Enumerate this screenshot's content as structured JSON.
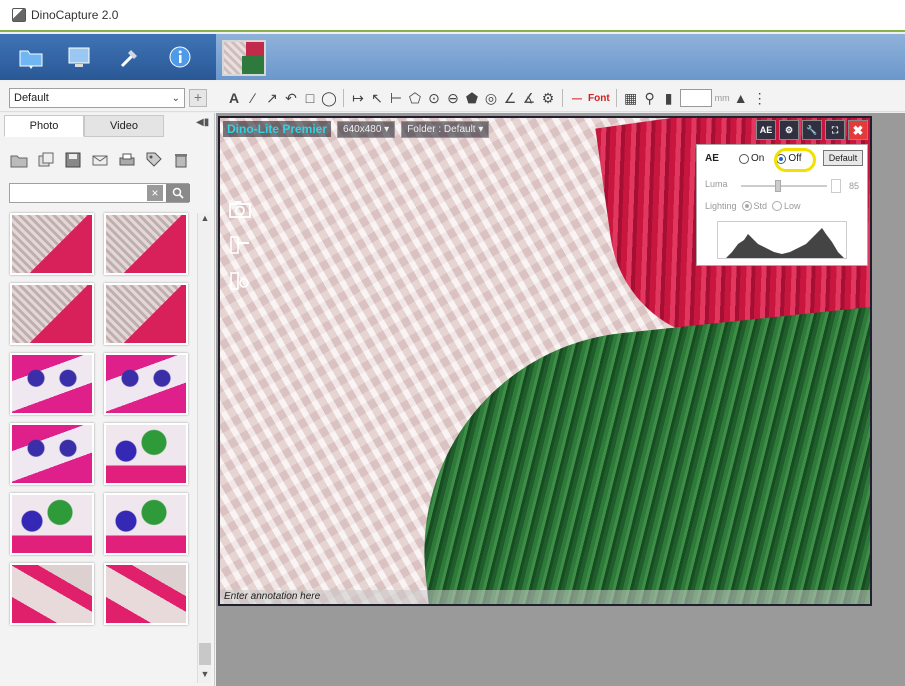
{
  "window": {
    "title": "DinoCapture 2.0"
  },
  "profile": {
    "selected": "Default"
  },
  "sidebar": {
    "tabs": [
      {
        "label": "Photo"
      },
      {
        "label": "Video"
      }
    ],
    "search": {
      "value": "",
      "placeholder": ""
    }
  },
  "viewer": {
    "model": "Dino-Lite Premier",
    "resolution": "640x480 ▾",
    "folder": "Folder : Default ▾",
    "annotation_placeholder": "Enter annotation here",
    "ae_button": "AE",
    "ae_button_sub": "OOX"
  },
  "ae_panel": {
    "ae_label": "AE",
    "on_label": "On",
    "off_label": "Off",
    "default_label": "Default",
    "luma_label": "Luma",
    "luma_value": "85",
    "lighting_label": "Lighting",
    "std_label": "Std",
    "low_label": "Low",
    "ae_state": "off"
  },
  "toolbar": {
    "font_label": "Font",
    "unit": "mm"
  },
  "colors": {
    "accent": "#2d5f9e",
    "model_text": "#2fd3e3",
    "highlight": "#f2e000",
    "close": "#e53a3a"
  }
}
